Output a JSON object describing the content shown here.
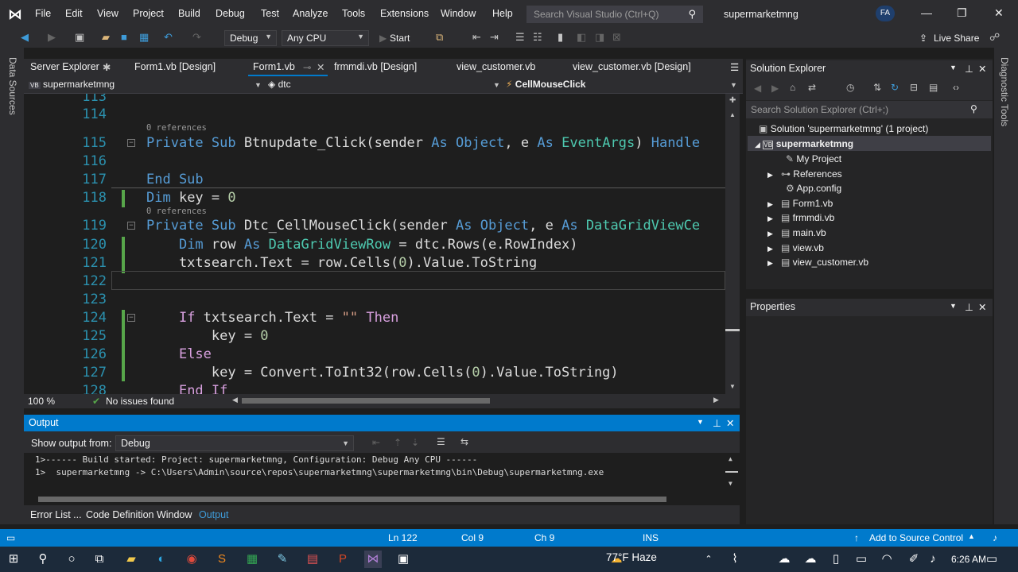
{
  "menu": [
    "File",
    "Edit",
    "View",
    "Project",
    "Build",
    "Debug",
    "Test",
    "Analyze",
    "Tools",
    "Extensions",
    "Window",
    "Help"
  ],
  "search": {
    "placeholder": "Search Visual Studio (Ctrl+Q)"
  },
  "window": {
    "solution_name": "supermarketmng",
    "avatar_initials": "FA"
  },
  "toolbar": {
    "configuration": "Debug",
    "platform": "Any CPU",
    "start_label": "Start",
    "live_share": "Live Share"
  },
  "left_tabs": {
    "data_sources": "Data Sources"
  },
  "right_tabs": {
    "diagnostic_tools": "Diagnostic Tools"
  },
  "doc_tabs": [
    "Server Explorer",
    "Form1.vb [Design]",
    "Form1.vb",
    "frmmdi.vb [Design]",
    "view_customer.vb",
    "view_customer.vb [Design]"
  ],
  "nav_bar": {
    "project": "supermarketmng",
    "object": "dtc",
    "member": "CellMouseClick"
  },
  "editor": {
    "line_numbers": [
      "113",
      "114",
      "115",
      "116",
      "117",
      "118",
      "119",
      "120",
      "121",
      "122",
      "123",
      "124",
      "125",
      "126",
      "127",
      "128"
    ],
    "references_label": "0 references",
    "zoom": "100 %",
    "issues": "No issues found"
  },
  "output": {
    "title": "Output",
    "show_output_from": "Show output from:",
    "source": "Debug",
    "lines": [
      "1>------ Build started: Project: supermarketmng, Configuration: Debug Any CPU ------",
      "1>  supermarketmng -> C:\\Users\\Admin\\source\\repos\\supermarketmng\\supermarketmng\\bin\\Debug\\supermarketmng.exe"
    ]
  },
  "bottom_tabs": [
    "Error List ...",
    "Code Definition Window",
    "Output"
  ],
  "solution_explorer": {
    "title": "Solution Explorer",
    "search_placeholder": "Search Solution Explorer (Ctrl+;)",
    "items": [
      {
        "label": "Solution 'supermarketmng' (1 project)"
      },
      {
        "label": "supermarketmng"
      },
      {
        "label": "My Project"
      },
      {
        "label": "References"
      },
      {
        "label": "App.config"
      },
      {
        "label": "Form1.vb"
      },
      {
        "label": "frmmdi.vb"
      },
      {
        "label": "main.vb"
      },
      {
        "label": "view.vb"
      },
      {
        "label": "view_customer.vb"
      }
    ]
  },
  "properties": {
    "title": "Properties"
  },
  "status": {
    "ln": "Ln 122",
    "col": "Col 9",
    "ch": "Ch 9",
    "mode": "INS",
    "source_control": "Add to Source Control"
  },
  "taskbar": {
    "weather": "77°F  Haze",
    "time": "6:26 AM"
  }
}
